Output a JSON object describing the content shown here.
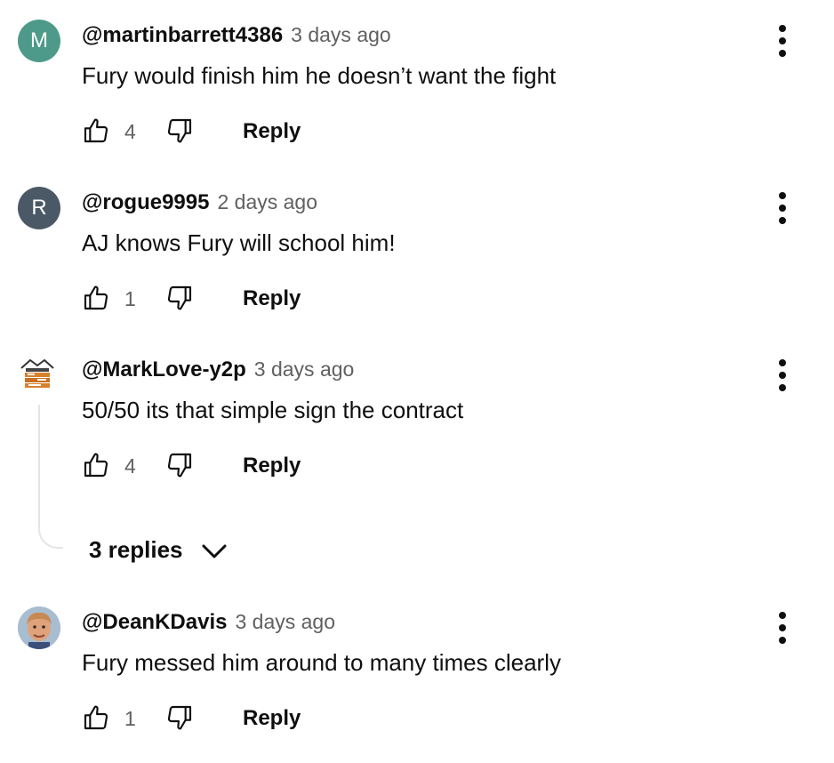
{
  "comments": [
    {
      "author": "@martinbarrett4386",
      "time": "3 days ago",
      "text": "Fury would finish him he doesn’t want the fight",
      "likes": "4",
      "reply_label": "Reply",
      "avatar": {
        "letter": "M",
        "color": "#4e9a8a"
      }
    },
    {
      "author": "@rogue9995",
      "time": "2 days ago",
      "text": "AJ knows Fury will school him!",
      "likes": "1",
      "reply_label": "Reply",
      "avatar": {
        "letter": "R",
        "color": "#4a5965"
      }
    },
    {
      "author": "@MarkLove-y2p",
      "time": "3 days ago",
      "text": "50/50 its that simple sign the contract",
      "likes": "4",
      "reply_label": "Reply",
      "avatar": {
        "icon": "house-logo-icon"
      }
    },
    {
      "author": "@DeanKDavis",
      "time": "3 days ago",
      "text": "Fury messed him around to many times clearly",
      "likes": "1",
      "reply_label": "Reply",
      "avatar": {
        "icon": "profile-photo-boy"
      }
    }
  ],
  "replies_toggle": {
    "label": "3 replies"
  }
}
